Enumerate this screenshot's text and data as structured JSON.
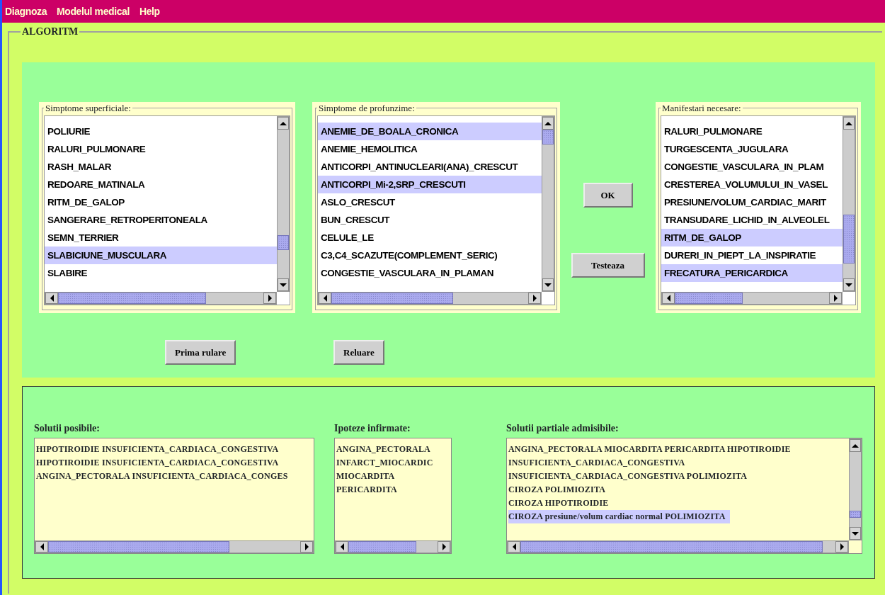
{
  "menu": [
    {
      "label": "Diagnoza"
    },
    {
      "label": "Modelul medical"
    },
    {
      "label": "Help"
    }
  ],
  "algoritm": {
    "title": "ALGORITM",
    "lists": [
      {
        "title": "Simptome superficiale:",
        "items": [
          {
            "label": "POLIURIE",
            "selected": false
          },
          {
            "label": "RALURI_PULMONARE",
            "selected": false
          },
          {
            "label": "RASH_MALAR",
            "selected": false
          },
          {
            "label": "REDOARE_MATINALA",
            "selected": false
          },
          {
            "label": "RITM_DE_GALOP",
            "selected": false
          },
          {
            "label": "SANGERARE_RETROPERITONEALA",
            "selected": false
          },
          {
            "label": "SEMN_TERRIER",
            "selected": false
          },
          {
            "label": "SLABICIUNE_MUSCULARA",
            "selected": true
          },
          {
            "label": "SLABIRE",
            "selected": false
          }
        ]
      },
      {
        "title": "Simptome de profunzime:",
        "items": [
          {
            "label": "ANEMIE_DE_BOALA_CRONICA",
            "selected": true
          },
          {
            "label": "ANEMIE_HEMOLITICA",
            "selected": false
          },
          {
            "label": "ANTICORPI_ANTINUCLEARI(ANA)_CRESCUT",
            "selected": false
          },
          {
            "label": "ANTICORPI_Mi-2,SRP_CRESCUTI",
            "selected": true
          },
          {
            "label": "ASLO_CRESCUT",
            "selected": false
          },
          {
            "label": "BUN_CRESCUT",
            "selected": false
          },
          {
            "label": "CELULE_LE",
            "selected": false
          },
          {
            "label": "C3,C4_SCAZUTE(COMPLEMENT_SERIC)",
            "selected": false
          },
          {
            "label": "CONGESTIE_VASCULARA_IN_PLAMAN",
            "selected": false
          }
        ]
      },
      {
        "title": "Manifestari necesare:",
        "items": [
          {
            "label": "RALURI_PULMONARE",
            "selected": false
          },
          {
            "label": "TURGESCENTA_JUGULARA",
            "selected": false
          },
          {
            "label": "CONGESTIE_VASCULARA_IN_PLAM",
            "selected": false
          },
          {
            "label": "CRESTEREA_VOLUMULUI_IN_VASEL",
            "selected": false
          },
          {
            "label": "PRESIUNE/VOLUM_CARDIAC_MARIT",
            "selected": false
          },
          {
            "label": "TRANSUDARE_LICHID_IN_ALVEOLEL",
            "selected": false
          },
          {
            "label": "RITM_DE_GALOP",
            "selected": true
          },
          {
            "label": "DURERI_IN_PIEPT_LA_INSPIRATIE",
            "selected": false
          },
          {
            "label": "FRECATURA_PERICARDICA",
            "selected": true
          }
        ]
      }
    ],
    "buttons": {
      "first_run": "Prima rulare",
      "rerun": "Reluare",
      "ok": "OK",
      "test": "Testeaza"
    }
  },
  "results": [
    {
      "title": "Solutii posibile:",
      "lines": [
        {
          "text": "HIPOTIROIDIE INSUFICIENTA_CARDIACA_CONGESTIVA",
          "selected": false
        },
        {
          "text": "HIPOTIROIDIE INSUFICIENTA_CARDIACA_CONGESTIVA",
          "selected": false
        },
        {
          "text": "ANGINA_PECTORALA INSUFICIENTA_CARDIACA_CONGES",
          "selected": false
        }
      ]
    },
    {
      "title": "Ipoteze infirmate:",
      "lines": [
        {
          "text": "ANGINA_PECTORALA",
          "selected": false
        },
        {
          "text": "INFARCT_MIOCARDIC",
          "selected": false
        },
        {
          "text": "MIOCARDITA",
          "selected": false
        },
        {
          "text": "PERICARDITA",
          "selected": false
        }
      ]
    },
    {
      "title": "Solutii partiale admisibile:",
      "lines": [
        {
          "text": "ANGINA_PECTORALA MIOCARDITA PERICARDITA HIPOTIROIDIE",
          "selected": false
        },
        {
          "text": "INSUFICIENTA_CARDIACA_CONGESTIVA",
          "selected": false
        },
        {
          "text": "INSUFICIENTA_CARDIACA_CONGESTIVA POLIMIOZITA",
          "selected": false
        },
        {
          "text": "CIROZA POLIMIOZITA",
          "selected": false
        },
        {
          "text": "CIROZA HIPOTIROIDIE",
          "selected": false
        },
        {
          "text": "CIROZA presiune/volum cardiac normal POLIMIOZITA",
          "selected": true
        }
      ]
    }
  ]
}
